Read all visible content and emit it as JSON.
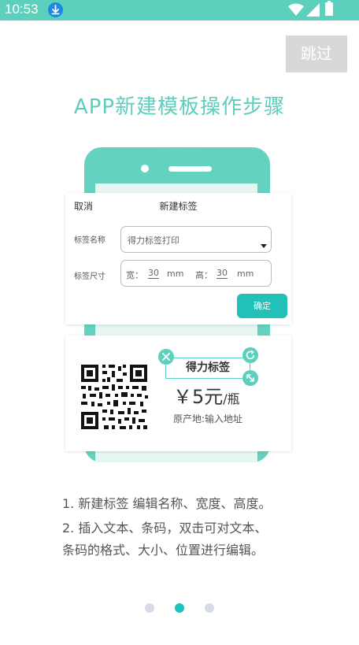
{
  "status_bar": {
    "time": "10:53",
    "icons": [
      "download-icon",
      "wifi-icon",
      "signal-icon",
      "battery-icon"
    ]
  },
  "skip_label": "跳过",
  "title": "APP新建模板操作步骤",
  "dialog": {
    "cancel": "取消",
    "title": "新建标签",
    "name_label": "标签名称",
    "name_value": "得力标签打印",
    "size_label": "标签尺寸",
    "width_label": "宽：",
    "width_value": "30",
    "width_unit": "mm",
    "height_label": "高：",
    "height_value": "30",
    "height_unit": "mm",
    "confirm": "确定"
  },
  "label_preview": {
    "title": "得力标签",
    "price": "￥5元",
    "price_unit": "/瓶",
    "origin": "原产地:输入地址"
  },
  "instructions": {
    "line1": "1.  新建标签 编辑名称、宽度、高度。",
    "line2": "2. 插入文本、条码，双击可对文本、",
    "line3": "条码的格式、大小、位置进行编辑。"
  },
  "pager": {
    "count": 3,
    "active_index": 1
  },
  "colors": {
    "accent": "#5ccfbd",
    "button": "#23c0b8",
    "dot_active": "#1ec2c0",
    "dot_inactive": "#d6dbe8",
    "skip_bg": "#d8d8d8"
  }
}
